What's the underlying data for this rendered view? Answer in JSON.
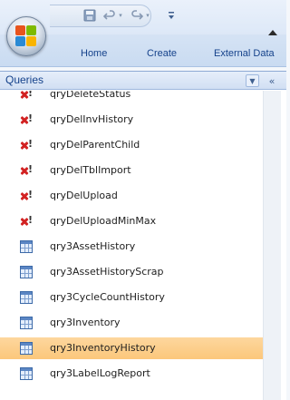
{
  "ribbon": {
    "tabs": [
      "Home",
      "Create",
      "External Data"
    ]
  },
  "quick_access": {
    "icons": [
      "save-icon",
      "undo-icon",
      "redo-icon",
      "customize-dropdown-icon"
    ]
  },
  "nav_pane": {
    "title": "Queries",
    "items": [
      {
        "label": "qryDeleteStatus",
        "icon": "delete-query-icon"
      },
      {
        "label": "qryDelInvHistory",
        "icon": "delete-query-icon"
      },
      {
        "label": "qryDelParentChild",
        "icon": "delete-query-icon"
      },
      {
        "label": "qryDelTblImport",
        "icon": "delete-query-icon"
      },
      {
        "label": "qryDelUpload",
        "icon": "delete-query-icon"
      },
      {
        "label": "qryDelUploadMinMax",
        "icon": "delete-query-icon"
      },
      {
        "label": "qry3AssetHistory",
        "icon": "select-query-icon"
      },
      {
        "label": "qry3AssetHistoryScrap",
        "icon": "select-query-icon"
      },
      {
        "label": "qry3CycleCountHistory",
        "icon": "select-query-icon"
      },
      {
        "label": "qry3Inventory",
        "icon": "select-query-icon"
      },
      {
        "label": "qry3InventoryHistory",
        "icon": "select-query-icon",
        "selected": true
      },
      {
        "label": "qry3LabelLogReport",
        "icon": "select-query-icon"
      }
    ]
  },
  "colors": {
    "selection": "#fcc77b",
    "delete_icon": "#d22222",
    "link_text": "#15428b"
  }
}
